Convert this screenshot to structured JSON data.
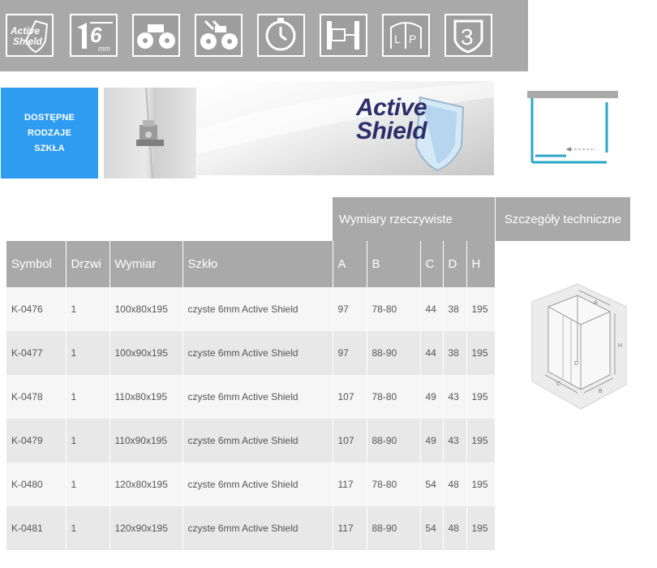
{
  "features": {
    "icons": [
      "active-shield-icon",
      "glass-6mm-icon",
      "wheels-icon",
      "wheels-adjustable-icon",
      "clock-icon",
      "wall-profile-icon",
      "reversible-lp-icon",
      "warranty-3-icon"
    ],
    "active_shield_text_1": "Active",
    "active_shield_text_2": "Shield",
    "glass_thickness": "6",
    "glass_unit": "mm",
    "reversible_left": "L",
    "reversible_right": "P",
    "warranty_years": "3"
  },
  "banner": {
    "glass_types_line1": "DOSTĘPNE",
    "glass_types_line2": "RODZAJE",
    "glass_types_line3": "SZKŁA",
    "logo_line1": "Active",
    "logo_line2": "Shield"
  },
  "table": {
    "group_dimensions": "Wymiary rzeczywiste",
    "group_technical": "Szczegóły techniczne",
    "columns": [
      "Symbol",
      "Drzwi",
      "Wymiar",
      "Szkło",
      "A",
      "B",
      "C",
      "D",
      "H"
    ],
    "rows": [
      [
        "K-0476",
        "1",
        "100x80x195",
        "czyste 6mm Active Shield",
        "97",
        "78-80",
        "44",
        "38",
        "195"
      ],
      [
        "K-0477",
        "1",
        "100x90x195",
        "czyste 6mm Active Shield",
        "97",
        "88-90",
        "44",
        "38",
        "195"
      ],
      [
        "K-0478",
        "1",
        "110x80x195",
        "czyste 6mm Active Shield",
        "107",
        "78-80",
        "49",
        "43",
        "195"
      ],
      [
        "K-0479",
        "1",
        "110x90x195",
        "czyste 6mm Active Shield",
        "107",
        "88-90",
        "49",
        "43",
        "195"
      ],
      [
        "K-0480",
        "1",
        "120x80x195",
        "czyste 6mm Active Shield",
        "117",
        "78-80",
        "54",
        "48",
        "195"
      ],
      [
        "K-0481",
        "1",
        "120x90x195",
        "czyste 6mm Active Shield",
        "117",
        "88-90",
        "54",
        "48",
        "195"
      ]
    ]
  },
  "drawing_labels": {
    "a": "A",
    "b": "B",
    "c": "C",
    "d": "D",
    "h": "H"
  },
  "colors": {
    "bar_gray": "#a9a9a9",
    "accent_blue": "#2e9cf0",
    "logo_navy": "#2d2f6b",
    "plan_cyan": "#2aa6c8"
  }
}
